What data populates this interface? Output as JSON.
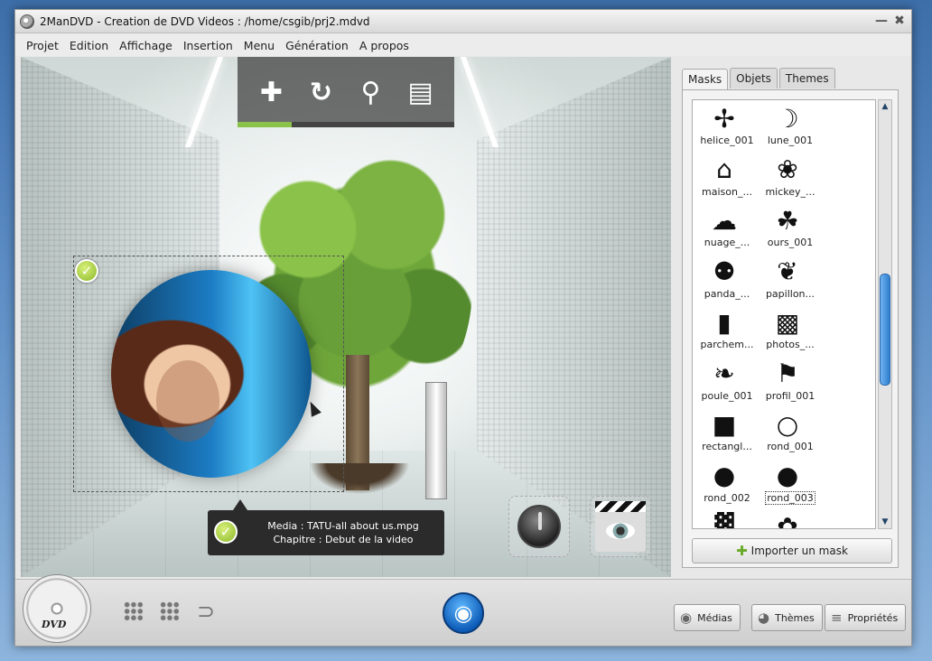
{
  "window": {
    "title": "2ManDVD - Creation de DVD Videos : /home/csgib/prj2.mdvd",
    "minimize_glyph": "—",
    "close_glyph": "✖"
  },
  "menu": [
    {
      "label": "Projet"
    },
    {
      "label": "Edition"
    },
    {
      "label": "Affichage"
    },
    {
      "label": "Insertion"
    },
    {
      "label": "Menu"
    },
    {
      "label": "Génération"
    },
    {
      "label": "A propos"
    }
  ],
  "stage_toolbar": {
    "buttons": [
      {
        "icon": "move-icon",
        "glyph": "✚"
      },
      {
        "icon": "refresh-icon",
        "glyph": "↻"
      },
      {
        "icon": "zoom-icon",
        "glyph": "⚲"
      },
      {
        "icon": "print-icon",
        "glyph": "▤"
      }
    ],
    "progress": 0.25,
    "progress_color": "#8bc34a"
  },
  "tooltip": {
    "media": "Media : TATU-all about us.mpg",
    "chapter": "Chapitre : Debut de la video"
  },
  "side_panel": {
    "tabs": [
      {
        "label": "Masks",
        "active": true
      },
      {
        "label": "Objets",
        "active": false
      },
      {
        "label": "Themes",
        "active": false
      }
    ],
    "masks": [
      {
        "label": "helice_001",
        "icon": "propeller-icon",
        "glyph": "✢"
      },
      {
        "label": "lune_001",
        "icon": "moon-icon",
        "glyph": "☽"
      },
      {
        "label": "maison_...",
        "icon": "house-icon",
        "glyph": "⌂"
      },
      {
        "label": "mickey_...",
        "icon": "mickey-icon",
        "glyph": "❀"
      },
      {
        "label": "nuage_...",
        "icon": "cloud-icon",
        "glyph": "☁"
      },
      {
        "label": "ours_001",
        "icon": "bear-icon",
        "glyph": "☘"
      },
      {
        "label": "panda_...",
        "icon": "panda-icon",
        "glyph": "⚉"
      },
      {
        "label": "papillon...",
        "icon": "butterfly-icon",
        "glyph": "❦"
      },
      {
        "label": "parchem...",
        "icon": "parchment-icon",
        "glyph": "▮"
      },
      {
        "label": "photos_...",
        "icon": "photos-icon",
        "glyph": "▩"
      },
      {
        "label": "poule_001",
        "icon": "chicken-icon",
        "glyph": "❧"
      },
      {
        "label": "profil_001",
        "icon": "profile-icon",
        "glyph": "⚑"
      },
      {
        "label": "rectangl...",
        "icon": "rectangle-icon",
        "glyph": "■"
      },
      {
        "label": "rond_001",
        "icon": "circle-outline-icon",
        "glyph": "○"
      },
      {
        "label": "rond_002",
        "icon": "circle-filled-icon",
        "glyph": "●"
      },
      {
        "label": "rond_003",
        "icon": "circle-soft-icon",
        "glyph": "●",
        "selected": true
      },
      {
        "label": "",
        "icon": "stripes-icon",
        "glyph": "▓"
      },
      {
        "label": "",
        "icon": "flower-icon",
        "glyph": "✿"
      }
    ],
    "import_label": "Importer un mask",
    "scroll_position": 0.55
  },
  "bottom_bar": {
    "dvd_text": "DVD",
    "buttons": [
      {
        "label": "Médias",
        "icon": "media-icon",
        "glyph": "◉"
      },
      {
        "label": "Thèmes",
        "icon": "globe-icon",
        "glyph": "◕"
      },
      {
        "label": "Propriétés",
        "icon": "sliders-icon",
        "glyph": "≡"
      }
    ]
  }
}
